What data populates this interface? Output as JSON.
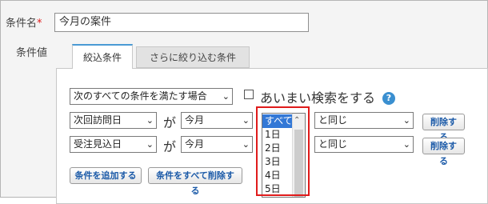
{
  "form": {
    "title_label": "条件名",
    "required_mark": "*",
    "title_value": "今月の案件",
    "condition_label": "条件値"
  },
  "tabs": [
    {
      "label": "絞込条件",
      "active": true
    },
    {
      "label": "さらに絞り込む条件",
      "active": false
    }
  ],
  "panel": {
    "match_select": "次のすべての条件を満たす場合",
    "fuzzy_label": "あいまい検索をする",
    "help_icon": "?",
    "rows": [
      {
        "field": "次回訪問日",
        "particle": "が",
        "period": "今月",
        "list_selected": "すべて",
        "operator": "と同じ",
        "delete_label": "削除する"
      },
      {
        "field": "受注見込日",
        "particle": "が",
        "period": "今月",
        "operator": "と同じ",
        "delete_label": "削除する"
      }
    ],
    "add_button": "条件を追加する",
    "delete_all_button": "条件をすべて削除する"
  },
  "dropdown_list": {
    "options": [
      "すべて",
      "1日",
      "2日",
      "3日",
      "4日",
      "5日"
    ],
    "selected_index": 0
  },
  "colors": {
    "accent": "#3a8fd0",
    "selection": "#3378d6",
    "highlight": "#e01b1b",
    "required": "#e01b1b"
  }
}
